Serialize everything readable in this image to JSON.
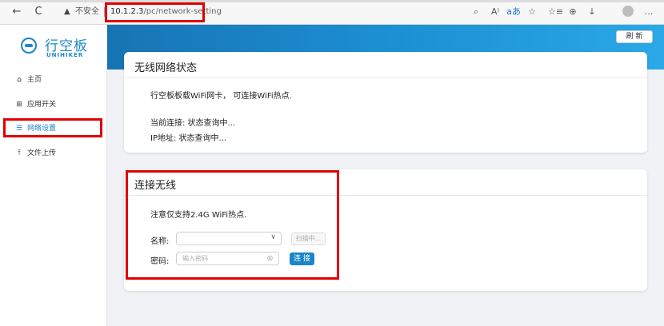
{
  "browser": {
    "back_icon": "←",
    "reload_icon": "C",
    "warning_icon": "▲",
    "not_secure": "不安全",
    "url_host": "10.1.2.3",
    "url_path": "/pc/network-setting",
    "tools": [
      "⌕",
      "A⁾",
      "aあ",
      "☆",
      "☆≡",
      "⊕",
      "↓",
      "…"
    ],
    "accent": "#e00000"
  },
  "sidebar": {
    "logo_cn": "行空板",
    "logo_en": "UNIHIKER",
    "items": [
      {
        "icon": "⌂",
        "label": "主页"
      },
      {
        "icon": "⊞",
        "label": "应用开关"
      },
      {
        "icon": "☰",
        "label": "网络设置"
      },
      {
        "icon": "⤒",
        "label": "文件上传"
      }
    ],
    "accent": "#1a86c8"
  },
  "header": {
    "refresh_label": "刷 新"
  },
  "status_card": {
    "title": "无线网络状态",
    "description": "行空板板载WiFi网卡， 可连接WiFi热点.",
    "current_connection": "当前连接: 状态查询中...",
    "ip_address": "IP地址:  状态查询中..."
  },
  "connect_card": {
    "title": "连接无线",
    "note": "注意仅支持2.4G WiFi热点.",
    "name_label": "名称:",
    "name_value": "",
    "scan_label": "扫描中...",
    "password_label": "密码:",
    "password_placeholder": "输入密码",
    "connect_label": "连 接"
  }
}
